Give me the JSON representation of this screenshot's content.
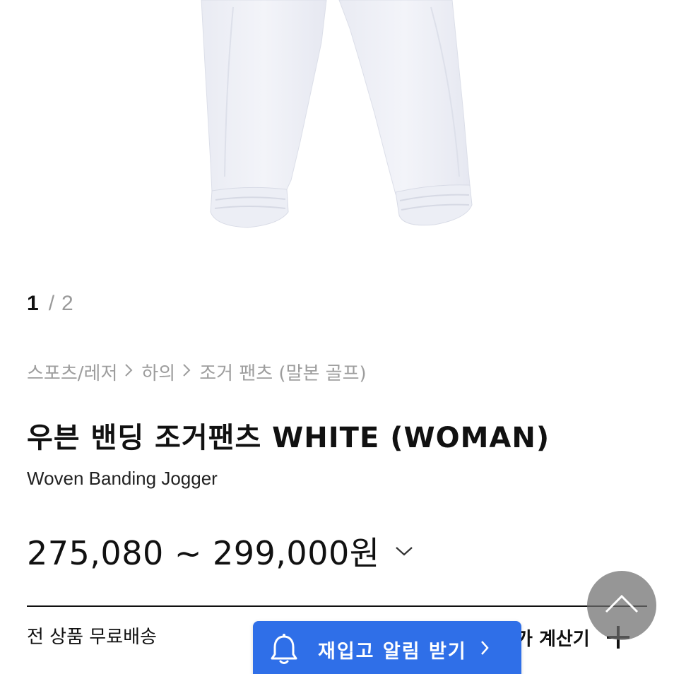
{
  "gallery": {
    "current": "1",
    "separator": "/",
    "total": "2",
    "image_alt": "white jogger pants"
  },
  "breadcrumb": {
    "items": [
      "스포츠/레저",
      "하의",
      "조거 팬츠 (말본 골프)"
    ],
    "separator_icon": "chevron-right-icon"
  },
  "product": {
    "title": "우븐 밴딩 조거팬츠 WHITE (WOMAN)",
    "subtitle": "Woven Banding Jogger",
    "price": "275,080 ~ 299,000원",
    "price_toggle_icon": "chevron-down-icon"
  },
  "shipping": {
    "text": "전 상품 무료배송"
  },
  "calculator": {
    "label": "가 계산기",
    "icon": "plus-icon"
  },
  "restock": {
    "label": "재입고 알림 받기",
    "icon": "bell-icon",
    "arrow_icon": "chevron-right-icon"
  },
  "scroll_top": {
    "icon": "chevron-up-icon"
  },
  "colors": {
    "accent": "#2f6fe8",
    "muted": "#9d9d9d",
    "text": "#111111"
  }
}
